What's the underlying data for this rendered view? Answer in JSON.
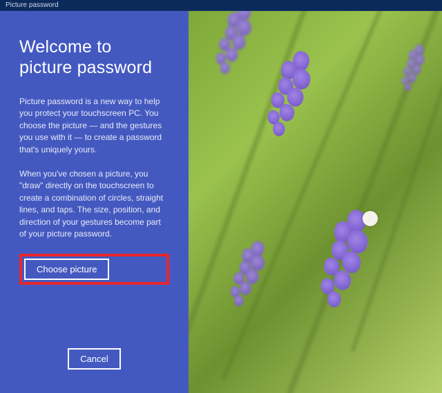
{
  "window": {
    "title": "Picture password"
  },
  "panel": {
    "heading": "Welcome to picture password",
    "paragraph1": "Picture password is a new way to help you protect your touchscreen PC. You choose the picture — and the gestures you use with it — to create a password that's uniquely yours.",
    "paragraph2": "When you've chosen a picture, you \"draw\" directly on the touchscreen to create a combination of circles, straight lines, and taps. The size, position, and direction of your gestures become part of your picture password.",
    "choose_label": "Choose picture",
    "cancel_label": "Cancel"
  }
}
